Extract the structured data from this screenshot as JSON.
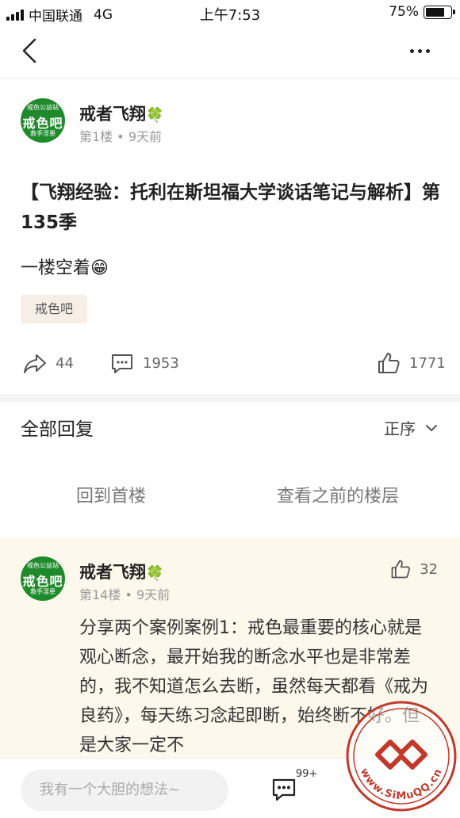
{
  "status": {
    "carrier": "中国联通",
    "network": "4G",
    "time": "上午7:53",
    "battery_percent": "75%",
    "battery_level": 0.75
  },
  "nav": {
    "back_icon": "chevron-left-icon",
    "more_icon": "more-dots-icon"
  },
  "post": {
    "avatar": {
      "top": "戒色公益站",
      "main": "戒色吧",
      "bottom": "救手淫患"
    },
    "author": "戒者飞翔",
    "author_badge": "🍀",
    "floor": "第1楼",
    "time": "9天前",
    "title": "【飞翔经验：托利在斯坦福大学谈话笔记与解析】第135季",
    "body": "一楼空着😁",
    "tag": "戒色吧",
    "shares": "44",
    "comments": "1953",
    "likes": "1771"
  },
  "replies": {
    "header": "全部回复",
    "sort_label": "正序",
    "jump_first": "回到首楼",
    "jump_previous": "查看之前的楼层"
  },
  "reply": {
    "avatar": {
      "top": "戒色公益站",
      "main": "戒色吧",
      "bottom": "救手淫患"
    },
    "author": "戒者飞翔",
    "author_badge": "🍀",
    "floor": "第14楼",
    "time": "9天前",
    "likes": "32",
    "text": "分享两个案例案例1：戒色最重要的核心就是观心断念，最开始我的断念水平也是非常差的，我不知道怎么去断，虽然每天都看《戒为良药》，每天练习念起即断，始终断不好。但是大家一定不"
  },
  "bottom": {
    "input_placeholder": "我有一个大胆的想法~",
    "comment_badge": "99+"
  },
  "watermark": {
    "text": "www.SiMuQQ.cn"
  },
  "colors": {
    "avatar_green": "#1f8a2c",
    "reply_bg": "#fcf8ec",
    "tag_bg": "#f7efe5",
    "watermark_red": "#c0392b"
  }
}
